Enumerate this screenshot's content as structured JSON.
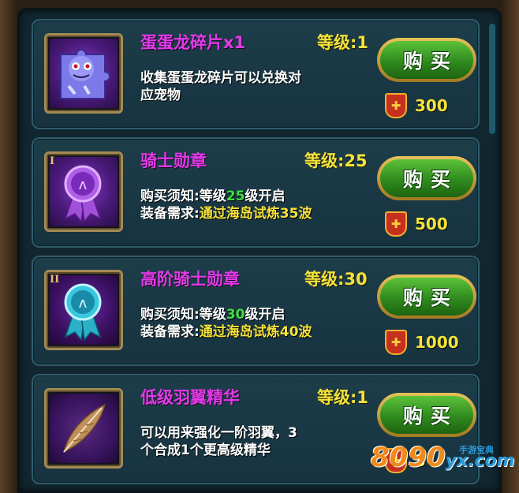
{
  "shop": {
    "items": [
      {
        "name": "蛋蛋龙碎片x1",
        "level": "等级:1",
        "desc_lines": [
          "收集蛋蛋龙碎片可以兑换对",
          "应宠物"
        ],
        "buy_label": "购买",
        "price": "300",
        "icon": "dragon-fragment-icon"
      },
      {
        "rank": "I",
        "name": "骑士勋章",
        "level": "等级:25",
        "req1_prefix": "购买须知:等级",
        "req1_value": "25",
        "req1_suffix": "级开启",
        "req2_prefix": "装备需求:",
        "req2_value": "通过海岛试炼35波",
        "buy_label": "购买",
        "price": "500",
        "icon": "knight-medal-icon"
      },
      {
        "rank": "II",
        "name": "高阶骑士勋章",
        "level": "等级:30",
        "req1_prefix": "购买须知:等级",
        "req1_value": "30",
        "req1_suffix": "级开启",
        "req2_prefix": "装备需求:",
        "req2_value": "通过海岛试炼40波",
        "buy_label": "购买",
        "price": "1000",
        "icon": "advanced-knight-medal-icon"
      },
      {
        "name": "低级羽翼精华",
        "level": "等级:1",
        "desc_lines": [
          "可以用来强化一阶羽翼，3",
          "个合成1个更高级精华"
        ],
        "buy_label": "购买",
        "price": "3",
        "icon": "feather-icon"
      }
    ]
  },
  "watermark": {
    "num": "8090",
    "domain": "yx.com",
    "small": "手游宝典"
  },
  "colors": {
    "name": "#e23ae8",
    "level": "#f4e23a",
    "buy": "#3a9a26",
    "price": "#f4e23a"
  }
}
